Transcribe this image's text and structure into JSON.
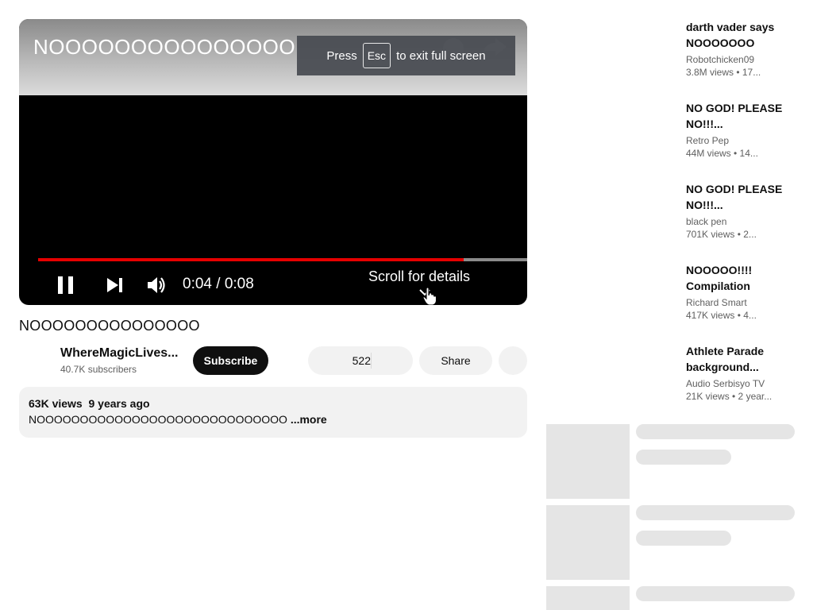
{
  "player": {
    "overlay_title": "NOOOOOOOOOOOOOOO",
    "esc_banner": {
      "prefix": "Press",
      "key": "Esc",
      "suffix": "to exit full screen"
    },
    "progress": 0.87,
    "time_display": "0:04 / 0:08",
    "scroll_hint": "Scroll for details",
    "icons": [
      "pause-icon",
      "next-icon",
      "volume-icon",
      "chevron-down-icon",
      "hand-cursor-icon",
      "clock-icon",
      "share-arrow-icon"
    ],
    "colors": {
      "progress_fill": "#e60000",
      "progress_track": "#8b8b8b"
    }
  },
  "video": {
    "title": "NOOOOOOOOOOOOOOO",
    "channel_name": "WhereMagicLives...",
    "subscribers": "40.7K subscribers",
    "subscribe_label": "Subscribe",
    "like_count": "522",
    "share_label": "Share",
    "views": "63K views",
    "age": "9 years ago",
    "description": "NOOOOOOOOOOOOOOOOOOOOOOOOOOOOO",
    "more_label": "...more"
  },
  "recommendations": [
    {
      "title_l1": "darth vader says",
      "title_l2": "NOOOOOOO",
      "channel": "Robotchicken09",
      "meta": "3.8M views • 17..."
    },
    {
      "title_l1": "NO GOD! PLEASE",
      "title_l2": "NO!!!...",
      "channel": "Retro Pep",
      "meta": "44M views • 14..."
    },
    {
      "title_l1": "NO GOD! PLEASE",
      "title_l2": "NO!!!...",
      "channel": "black pen",
      "meta": "701K views • 2..."
    },
    {
      "title_l1": "NOOOOO!!!!",
      "title_l2": "Compilation",
      "channel": "Richard Smart",
      "meta": "417K views • 4..."
    },
    {
      "title_l1": "Athlete Parade",
      "title_l2": "background...",
      "channel": "Audio Serbisyo TV",
      "meta": "21K views • 2 year..."
    }
  ]
}
